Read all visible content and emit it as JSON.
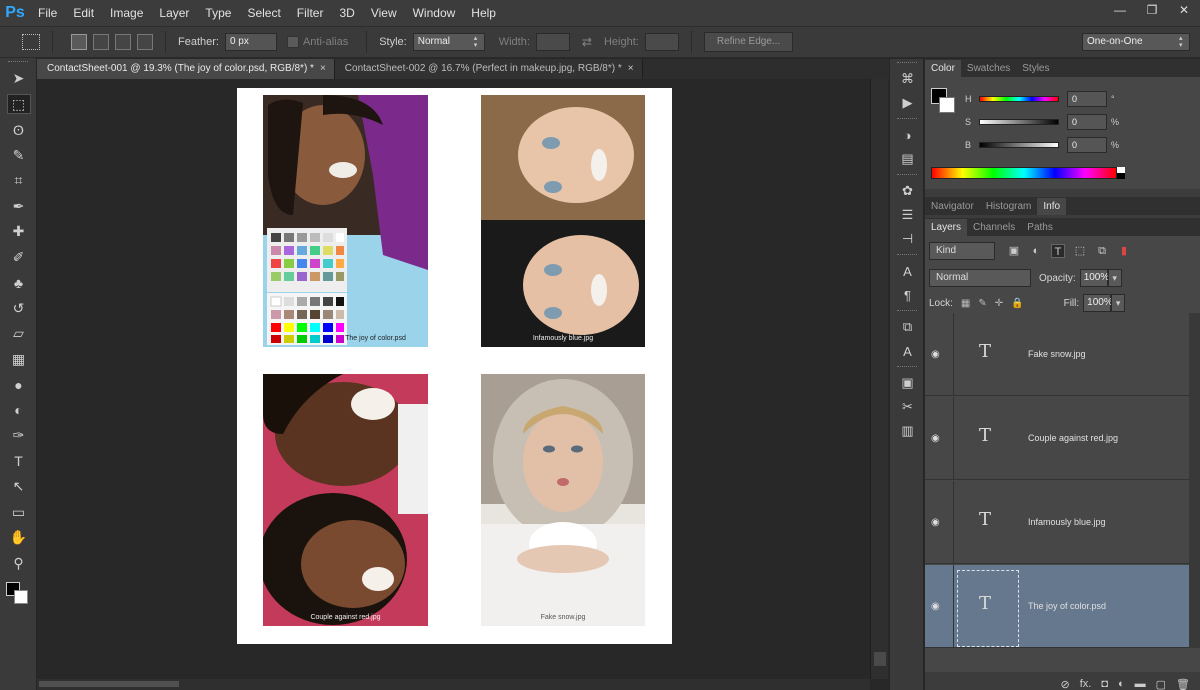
{
  "app": {
    "logo": "Ps"
  },
  "menu": [
    "File",
    "Edit",
    "Image",
    "Layer",
    "Type",
    "Select",
    "Filter",
    "3D",
    "View",
    "Window",
    "Help"
  ],
  "window_controls": [
    "—",
    "❐",
    "✕"
  ],
  "options": {
    "feather_label": "Feather:",
    "feather_value": "0 px",
    "antialias_label": "Anti-alias",
    "style_label": "Style:",
    "style_value": "Normal",
    "width_label": "Width:",
    "height_label": "Height:",
    "refine_edge": "Refine Edge...",
    "workspace": "One-on-One"
  },
  "tabs": [
    {
      "label": "ContactSheet-001 @ 19.3% (The joy of color.psd, RGB/8*) *",
      "close": "×"
    },
    {
      "label": "ContactSheet-002 @ 16.7% (Perfect in makeup.jpg, RGB/8*) *",
      "close": "×"
    }
  ],
  "photos": [
    {
      "caption": "The joy of color.psd"
    },
    {
      "caption": "Infamously blue.jpg"
    },
    {
      "caption": "Couple against red.jpg"
    },
    {
      "caption": "Fake snow.jpg"
    }
  ],
  "color_panel": {
    "tabs": [
      "Color",
      "Swatches",
      "Styles"
    ],
    "h_label": "H",
    "h_value": "0",
    "h_unit": "°",
    "s_label": "S",
    "s_value": "0",
    "s_unit": "%",
    "b_label": "B",
    "b_value": "0",
    "b_unit": "%"
  },
  "info_tabs": [
    "Navigator",
    "Histogram",
    "Info"
  ],
  "layers_panel": {
    "tabs": [
      "Layers",
      "Channels",
      "Paths"
    ],
    "kind": "Kind",
    "blend_mode": "Normal",
    "opacity_label": "Opacity:",
    "opacity_value": "100%",
    "lock_label": "Lock:",
    "fill_label": "Fill:",
    "fill_value": "100%",
    "layers": [
      {
        "name": "Fake snow.jpg",
        "glyph": "T"
      },
      {
        "name": "Couple against red.jpg",
        "glyph": "T"
      },
      {
        "name": "Infamously blue.jpg",
        "glyph": "T"
      },
      {
        "name": "The joy of color.psd",
        "glyph": "T"
      }
    ],
    "footer_icons": [
      "⊘",
      "fx.",
      "◘",
      "◐",
      "▬",
      "▢",
      "🗑"
    ]
  },
  "colors": {
    "selected_layer": "#66788d",
    "app_bg": "#282828"
  }
}
